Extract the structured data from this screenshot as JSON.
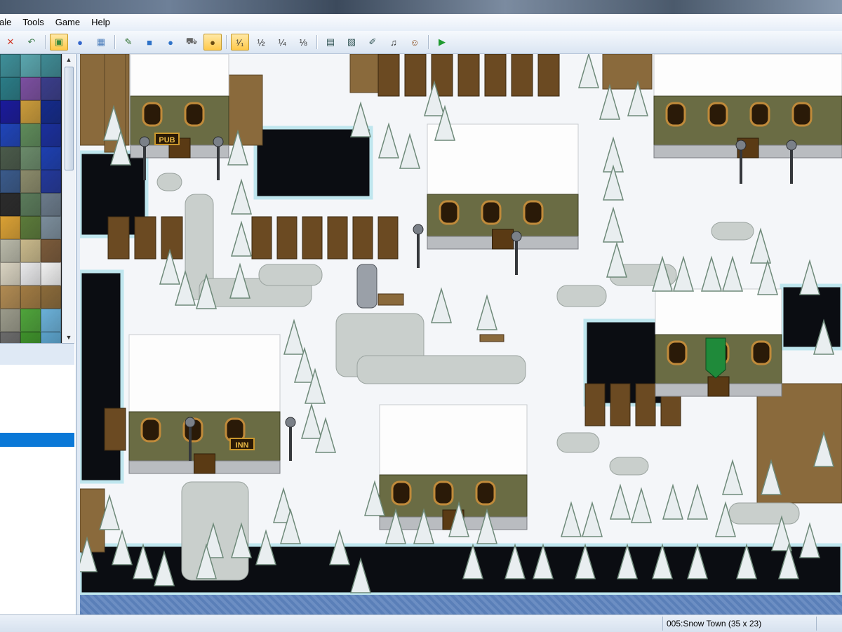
{
  "menu": {
    "items": [
      "ale",
      "Tools",
      "Game",
      "Help"
    ]
  },
  "toolbar": {
    "buttons": [
      {
        "name": "cut-icon",
        "glyph": "✕",
        "color": "#d03b2a"
      },
      {
        "name": "undo-icon",
        "glyph": "↶",
        "color": "#3d7a4b"
      },
      {
        "name": "map-layer-icon",
        "glyph": "▣",
        "color": "#3b8a3b",
        "active": true
      },
      {
        "name": "event-layer-icon",
        "glyph": "●",
        "color": "#3366cc"
      },
      {
        "name": "region-icon",
        "glyph": "▦",
        "color": "#4b7dbb"
      },
      {
        "name": "pencil-icon",
        "glyph": "✎",
        "color": "#2f6f2f"
      },
      {
        "name": "rectangle-icon",
        "glyph": "■",
        "color": "#2e72c8"
      },
      {
        "name": "ellipse-icon",
        "glyph": "●",
        "color": "#2e72c8"
      },
      {
        "name": "fill-icon",
        "glyph": "⛟",
        "color": "#666"
      },
      {
        "name": "shadow-pen-icon",
        "glyph": "●",
        "color": "#6a4b12",
        "active": true
      },
      {
        "name": "zoom-1-1-icon",
        "glyph": "¹⁄₁",
        "color": "#333",
        "active": true
      },
      {
        "name": "zoom-1-2-icon",
        "glyph": "½",
        "color": "#333"
      },
      {
        "name": "zoom-1-4-icon",
        "glyph": "¼",
        "color": "#333"
      },
      {
        "name": "zoom-1-8-icon",
        "glyph": "⅛",
        "color": "#333"
      },
      {
        "name": "database-icon",
        "glyph": "▤",
        "color": "#355"
      },
      {
        "name": "resource-manager-icon",
        "glyph": "▧",
        "color": "#355"
      },
      {
        "name": "script-editor-icon",
        "glyph": "✐",
        "color": "#355"
      },
      {
        "name": "sound-test-icon",
        "glyph": "♫",
        "color": "#333"
      },
      {
        "name": "character-generator-icon",
        "glyph": "☺",
        "color": "#8a4a1a"
      },
      {
        "name": "playtest-icon",
        "glyph": "▶",
        "color": "#1f9a2f"
      }
    ]
  },
  "tileset": {
    "colors": [
      "#3e8f99",
      "#5aa6ae",
      "#3f8a94",
      "#2a7b86",
      "#7b4fa0",
      "#3a3d8a",
      "#1a1a9a",
      "#c99a3a",
      "#142a8a",
      "#1f44b8",
      "#5e8a5a",
      "#1a2f9c",
      "#4a5a4a",
      "#6a8a6a",
      "#1d3fb0",
      "#3a5a8a",
      "#8a8a6a",
      "#23389a",
      "#2b2b2b",
      "#5a7a5a",
      "#6a7a8a",
      "#d9a034",
      "#5b7a3a",
      "#7b8d9b",
      "#b8b8a8",
      "#c8b88a",
      "#7a5a3a",
      "#d8d2c0",
      "#e8e8ea",
      "#f0f0f0",
      "#b08a52",
      "#a07a42",
      "#8a6a3a",
      "#9a9a8a",
      "#4ea33a",
      "#6ab0d8",
      "#6a6a6a",
      "#3d8f2a",
      "#5aa0c8"
    ]
  },
  "maptree": {
    "selected_index": 4
  },
  "map": {
    "buildings": [
      {
        "sign": "PUB"
      },
      {
        "sign": "INN"
      }
    ]
  },
  "status": {
    "map_name": "005:Snow Town (35 x 23)"
  }
}
